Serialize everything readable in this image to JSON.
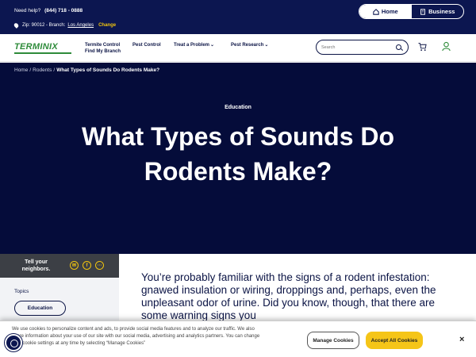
{
  "topbar": {
    "help_label": "Need help?",
    "phone": "(844) 718 - 0888",
    "location": "Zip: 90012 - Branch:",
    "city": "Los Angeles",
    "change": "Change",
    "toggle": {
      "home": "Home",
      "business": "Business"
    }
  },
  "nav": {
    "logo": "TERMINIX",
    "items": [
      "Termite Control",
      "Find My Branch",
      "Pest Control",
      "Treat a Problem",
      "Pest Research"
    ],
    "search_placeholder": "Search"
  },
  "hero": {
    "breadcrumb": [
      "Home",
      "Rodents",
      "What Types of Sounds Do Rodents Make?"
    ],
    "category": "Education",
    "title": "What Types of Sounds Do Rodents Make?"
  },
  "sidebar": {
    "share_label": "Tell your neighbors.",
    "topics_label": "Topics",
    "topic_pill": "Education"
  },
  "article": {
    "intro": "You’re probably familiar with the signs of a rodent infestation: gnawed insulation or wiring, droppings and, perhaps, even the unpleasant odor of urine. Did you know, though, that there are some warning signs you"
  },
  "cookie": {
    "text": "We use cookies to personalize content and ads, to provide social media features and to analyze our traffic. We also share information about your use of our site with our social media, advertising and analytics partners. You can change your cookie settings at any time by selecting “Manage Cookies”",
    "manage": "Manage Cookies",
    "accept": "Accept All Cookies",
    "close": "×"
  },
  "colors": {
    "topbar_bg": "#0c1650",
    "hero_bg": "#050c3a",
    "brand_green": "#2e8b3a",
    "accent_yellow": "#f5c518"
  }
}
